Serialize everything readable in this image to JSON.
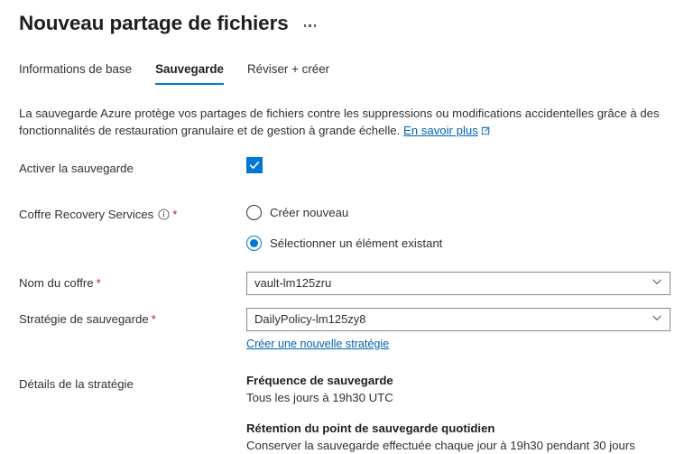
{
  "header": {
    "title": "Nouveau partage de fichiers",
    "more_menu_label": "..."
  },
  "tabs": [
    {
      "label": "Informations de base",
      "active": false
    },
    {
      "label": "Sauvegarde",
      "active": true
    },
    {
      "label": "Réviser + créer",
      "active": false
    }
  ],
  "description": {
    "text": "La sauvegarde Azure protège vos partages de fichiers contre les suppressions ou modifications accidentelles grâce à des fonctionnalités de restauration granulaire et de gestion à grande échelle.",
    "link_label": "En savoir plus"
  },
  "form": {
    "enable_backup": {
      "label": "Activer la sauvegarde",
      "checked": true
    },
    "vault_section": {
      "label": "Coffre Recovery Services",
      "required_marker": "*",
      "info_icon": "info-icon",
      "options": [
        {
          "label": "Créer nouveau",
          "selected": false
        },
        {
          "label": "Sélectionner un élément existant",
          "selected": true
        }
      ]
    },
    "vault_name": {
      "label": "Nom du coffre",
      "required_marker": "*",
      "value": "vault-lm125zru"
    },
    "backup_policy": {
      "label": "Stratégie de sauvegarde",
      "required_marker": "*",
      "value": "DailyPolicy-lm125zy8",
      "create_link": "Créer une nouvelle stratégie"
    },
    "policy_details": {
      "label": "Détails de la stratégie",
      "groups": [
        {
          "heading": "Fréquence de sauvegarde",
          "text": "Tous les jours à 19h30 UTC"
        },
        {
          "heading": "Rétention du point de sauvegarde quotidien",
          "text": "Conserver la sauvegarde effectuée chaque jour à 19h30 pendant 30 jours"
        }
      ]
    }
  },
  "colors": {
    "accent": "#0078d4",
    "link": "#0063b1",
    "required": "#a4262c",
    "text": "#323130"
  }
}
